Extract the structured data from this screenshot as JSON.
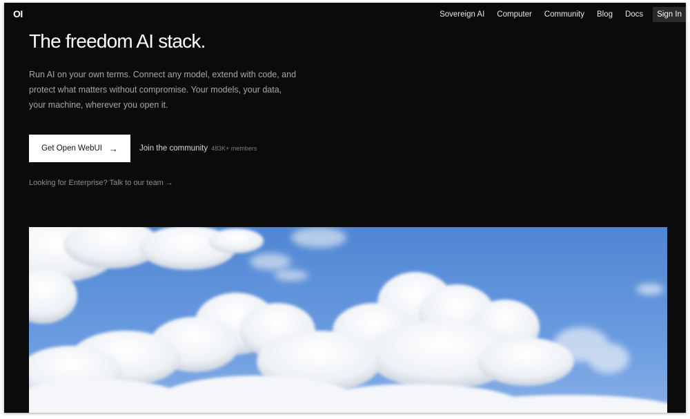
{
  "header": {
    "logo": "OI",
    "nav": [
      {
        "label": "Sovereign AI"
      },
      {
        "label": "Computer"
      },
      {
        "label": "Community"
      },
      {
        "label": "Blog"
      },
      {
        "label": "Docs"
      }
    ],
    "sign_in": "Sign In"
  },
  "hero": {
    "title": "The freedom AI stack.",
    "subtitle": "Run AI on your own terms. Connect any model, extend with code, and protect what matters without compromise. Your models, your data, your machine, wherever you open it.",
    "cta": {
      "label": "Get Open WebUI",
      "arrow": "→"
    },
    "community": {
      "label": "Join the community",
      "members": "483K+ members"
    },
    "enterprise": "Looking for Enterprise? Talk to our team →"
  },
  "colors": {
    "background": "#0b0b0c",
    "sky": "#5b8fd6",
    "button": "#ffffff"
  },
  "icons": {
    "arrow": "arrow-right-icon"
  }
}
